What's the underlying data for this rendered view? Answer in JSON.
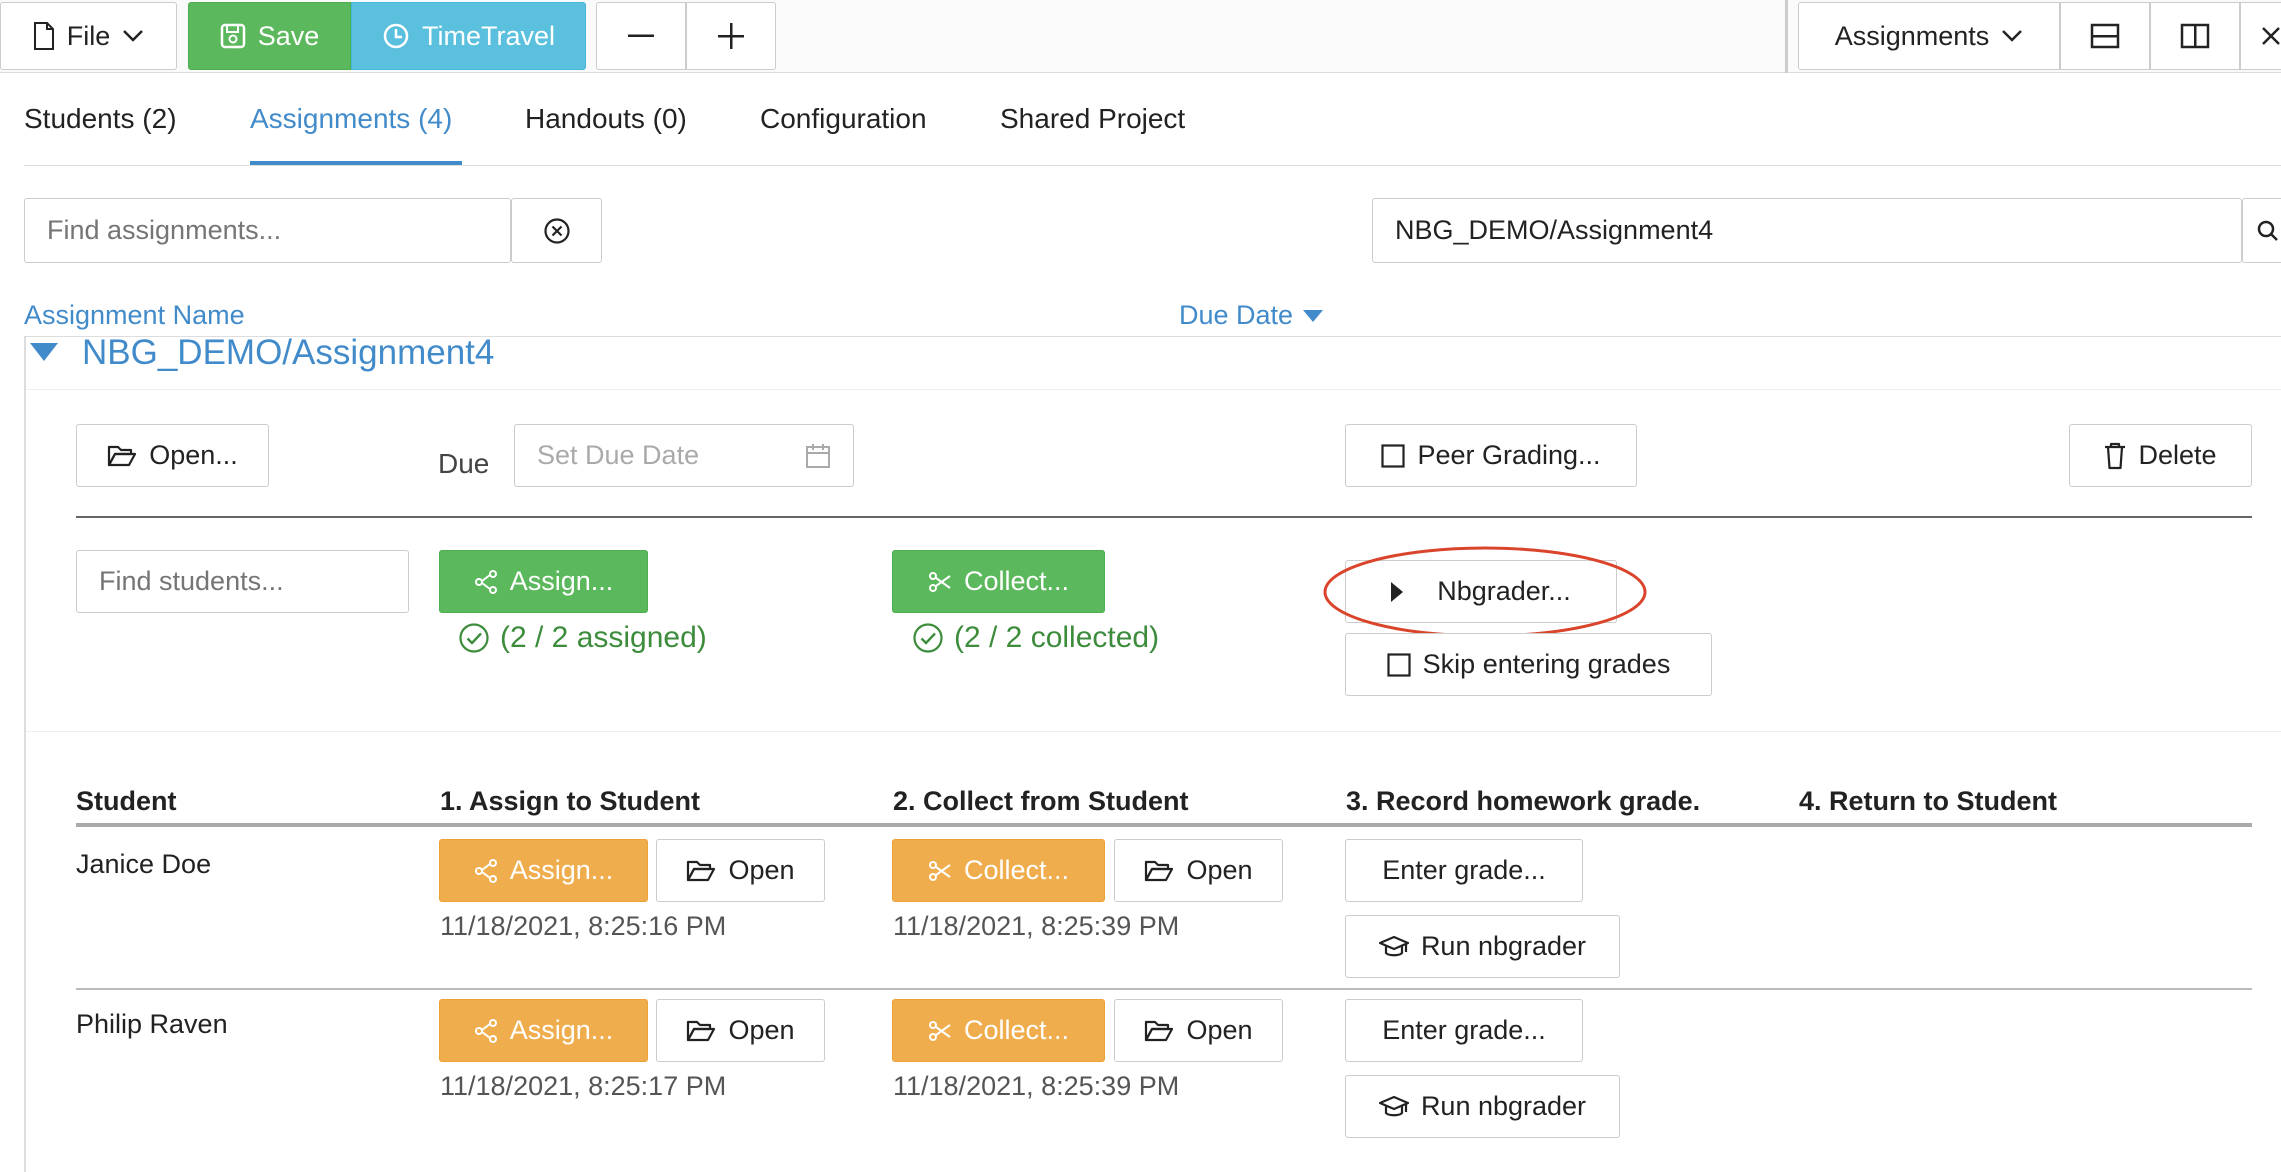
{
  "toolbar": {
    "file_label": "File",
    "save_label": "Save",
    "timetravel_label": "TimeTravel",
    "view_select_label": "Assignments"
  },
  "tabs": [
    {
      "label": "Students (2)"
    },
    {
      "label": "Assignments (4)"
    },
    {
      "label": "Handouts (0)"
    },
    {
      "label": "Configuration"
    },
    {
      "label": "Shared Project"
    }
  ],
  "search": {
    "placeholder": "Find assignments...",
    "path_value": "NBG_DEMO/Assignment4"
  },
  "list_header": {
    "name_label": "Assignment Name",
    "due_label": "Due Date"
  },
  "assignment": {
    "title": "NBG_DEMO/Assignment4",
    "open_label": "Open...",
    "due_label": "Due",
    "due_placeholder": "Set Due Date",
    "peer_grading_label": "Peer Grading...",
    "delete_label": "Delete",
    "find_students_placeholder": "Find students...",
    "assign_label": "Assign...",
    "collect_label": "Collect...",
    "nbgrader_label": "Nbgrader...",
    "skip_grades_label": "Skip entering grades",
    "assigned_status": "(2 / 2 assigned)",
    "collected_status": "(2 / 2 collected)"
  },
  "student_table": {
    "columns": [
      "Student",
      "1. Assign to Student",
      "2. Collect from Student",
      "3. Record homework grade.",
      "4. Return to Student"
    ],
    "actions": {
      "assign": "Assign...",
      "open": "Open",
      "collect": "Collect...",
      "enter_grade": "Enter grade...",
      "run_nbgrader": "Run nbgrader"
    },
    "rows": [
      {
        "name": "Janice Doe",
        "assigned_time": "11/18/2021, 8:25:16 PM",
        "collected_time": "11/18/2021, 8:25:39 PM"
      },
      {
        "name": "Philip Raven",
        "assigned_time": "11/18/2021, 8:25:17 PM",
        "collected_time": "11/18/2021, 8:25:39 PM"
      }
    ]
  },
  "colors": {
    "accent": "#428bca",
    "success": "#5cb85c",
    "warning": "#f0ad4e",
    "info": "#5bc0de",
    "annotation": "#d9442b"
  }
}
